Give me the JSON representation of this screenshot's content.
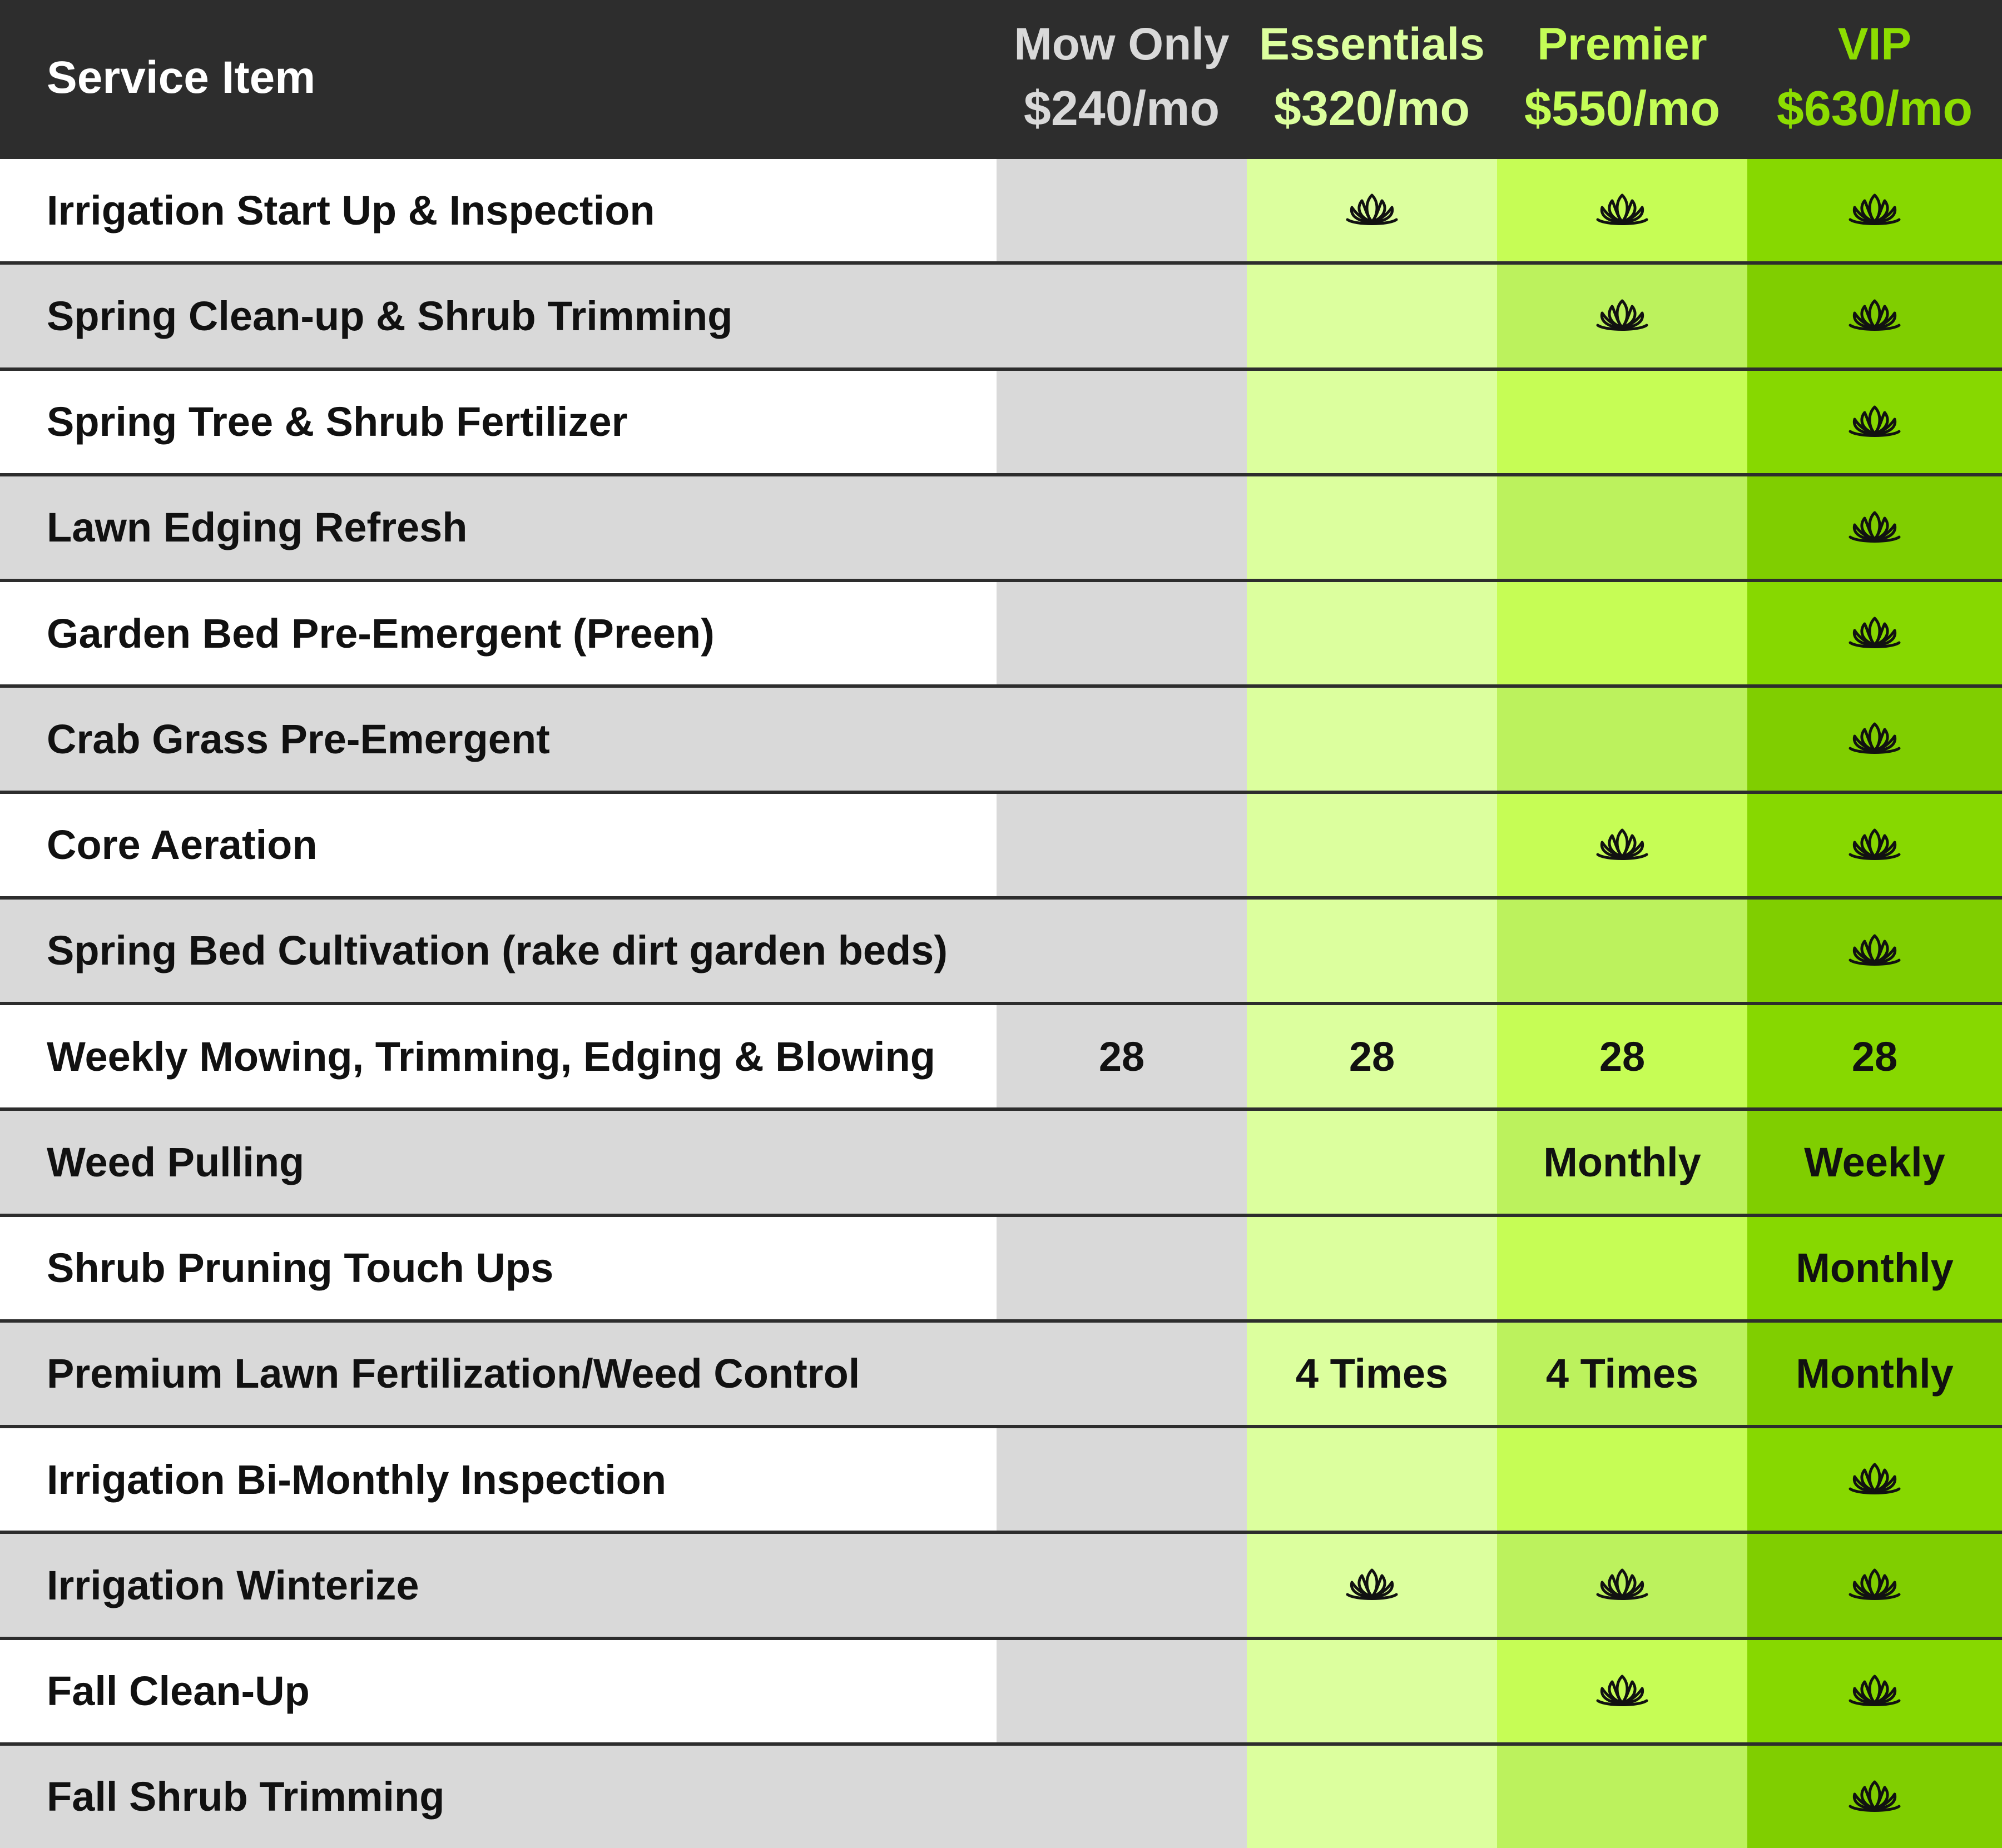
{
  "header": {
    "service_label": "Service Item",
    "plans": [
      {
        "name": "Mow Only",
        "price": "$240/mo",
        "color": "#d9d9d9"
      },
      {
        "name": "Essentials",
        "price": "$320/mo",
        "color": "#dcff9e"
      },
      {
        "name": "Premier",
        "price": "$550/mo",
        "color": "#c4fd56"
      },
      {
        "name": "VIP",
        "price": "$630/mo",
        "color": "#8ddd01"
      }
    ]
  },
  "colors": {
    "header_bg": "#2d2d2d",
    "label_white": "#ffffff",
    "label_gray": "#d9d9d9",
    "mow": "#d9d9d9",
    "essentials": "#dcff9e",
    "premier_a": "#c6fd55",
    "premier_b": "#bcf25d",
    "vip_a": "#87d800",
    "vip_b": "#80ce00"
  },
  "check_icon": "lotus-icon",
  "rows": [
    {
      "label": "Irrigation Start Up & Inspection",
      "values": [
        "",
        "✓",
        "✓",
        "✓"
      ]
    },
    {
      "label": "Spring Clean-up & Shrub Trimming",
      "values": [
        "",
        "",
        "✓",
        "✓"
      ]
    },
    {
      "label": "Spring Tree & Shrub Fertilizer",
      "values": [
        "",
        "",
        "",
        "✓"
      ]
    },
    {
      "label": "Lawn Edging Refresh",
      "values": [
        "",
        "",
        "",
        "✓"
      ]
    },
    {
      "label": "Garden Bed Pre-Emergent (Preen)",
      "values": [
        "",
        "",
        "",
        "✓"
      ]
    },
    {
      "label": "Crab Grass Pre-Emergent",
      "values": [
        "",
        "",
        "",
        "✓"
      ]
    },
    {
      "label": "Core Aeration",
      "values": [
        "",
        "",
        "✓",
        "✓"
      ]
    },
    {
      "label": "Spring Bed Cultivation (rake dirt garden beds)",
      "values": [
        "",
        "",
        "",
        "✓"
      ]
    },
    {
      "label": "Weekly Mowing, Trimming, Edging & Blowing",
      "values": [
        "28",
        "28",
        "28",
        "28"
      ]
    },
    {
      "label": "Weed Pulling",
      "values": [
        "",
        "",
        "Monthly",
        "Weekly"
      ]
    },
    {
      "label": "Shrub Pruning Touch Ups",
      "values": [
        "",
        "",
        "",
        "Monthly"
      ]
    },
    {
      "label": "Premium Lawn Fertilization/Weed Control",
      "values": [
        "",
        "4 Times",
        "4 Times",
        "Monthly"
      ]
    },
    {
      "label": "Irrigation Bi-Monthly Inspection",
      "values": [
        "",
        "",
        "",
        "✓"
      ]
    },
    {
      "label": "Irrigation Winterize",
      "values": [
        "",
        "✓",
        "✓",
        "✓"
      ]
    },
    {
      "label": "Fall Clean-Up",
      "values": [
        "",
        "",
        "✓",
        "✓"
      ]
    },
    {
      "label": "Fall Shrub Trimming",
      "values": [
        "",
        "",
        "",
        "✓"
      ]
    }
  ]
}
